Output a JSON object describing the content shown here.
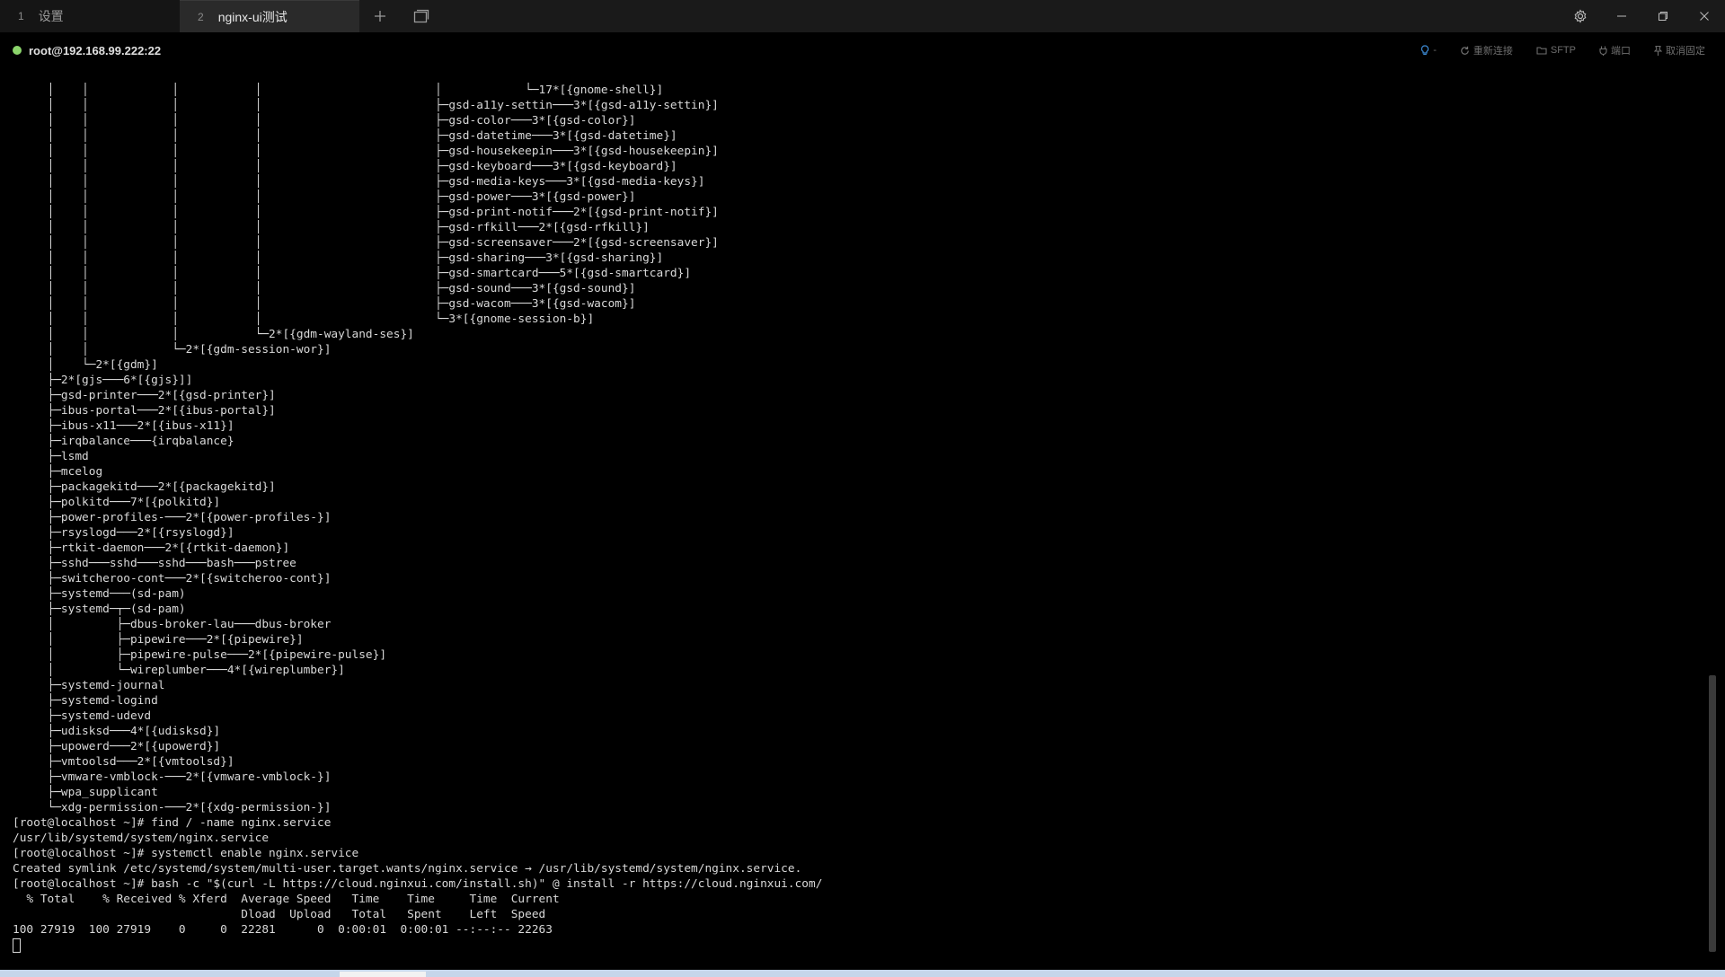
{
  "tabs": [
    {
      "num": "1",
      "label": "设置"
    },
    {
      "num": "2",
      "label": "nginx-ui测试"
    }
  ],
  "icons": {
    "new_tab": "plus-icon",
    "tab_overview": "tabs-icon",
    "settings": "gear-icon",
    "minimize": "minimize-icon",
    "restore": "restore-icon",
    "close": "close-icon"
  },
  "session": {
    "host": "root@192.168.99.222:22",
    "status_color": "#8bd46b",
    "bulb_label": "-",
    "reconnect": "重新连接",
    "sftp": "SFTP",
    "port": "端口",
    "unpin": "取消固定"
  },
  "terminal": {
    "lines": [
      "     │    │            │           │                         │            └─17*[{gnome-shell}]",
      "     │    │            │           │                         ├─gsd-a11y-settin───3*[{gsd-a11y-settin}]",
      "     │    │            │           │                         ├─gsd-color───3*[{gsd-color}]",
      "     │    │            │           │                         ├─gsd-datetime───3*[{gsd-datetime}]",
      "     │    │            │           │                         ├─gsd-housekeepin───3*[{gsd-housekeepin}]",
      "     │    │            │           │                         ├─gsd-keyboard───3*[{gsd-keyboard}]",
      "     │    │            │           │                         ├─gsd-media-keys───3*[{gsd-media-keys}]",
      "     │    │            │           │                         ├─gsd-power───3*[{gsd-power}]",
      "     │    │            │           │                         ├─gsd-print-notif───2*[{gsd-print-notif}]",
      "     │    │            │           │                         ├─gsd-rfkill───2*[{gsd-rfkill}]",
      "     │    │            │           │                         ├─gsd-screensaver───2*[{gsd-screensaver}]",
      "     │    │            │           │                         ├─gsd-sharing───3*[{gsd-sharing}]",
      "     │    │            │           │                         ├─gsd-smartcard───5*[{gsd-smartcard}]",
      "     │    │            │           │                         ├─gsd-sound───3*[{gsd-sound}]",
      "     │    │            │           │                         ├─gsd-wacom───3*[{gsd-wacom}]",
      "     │    │            │           │                         └─3*[{gnome-session-b}]",
      "     │    │            │           └─2*[{gdm-wayland-ses}]",
      "     │    │            └─2*[{gdm-session-wor}]",
      "     │    └─2*[{gdm}]",
      "     ├─2*[gjs───6*[{gjs}]]",
      "     ├─gsd-printer───2*[{gsd-printer}]",
      "     ├─ibus-portal───2*[{ibus-portal}]",
      "     ├─ibus-x11───2*[{ibus-x11}]",
      "     ├─irqbalance───{irqbalance}",
      "     ├─lsmd",
      "     ├─mcelog",
      "     ├─packagekitd───2*[{packagekitd}]",
      "     ├─polkitd───7*[{polkitd}]",
      "     ├─power-profiles-───2*[{power-profiles-}]",
      "     ├─rsyslogd───2*[{rsyslogd}]",
      "     ├─rtkit-daemon───2*[{rtkit-daemon}]",
      "     ├─sshd───sshd───sshd───bash───pstree",
      "     ├─switcheroo-cont───2*[{switcheroo-cont}]",
      "     ├─systemd───(sd-pam)",
      "     ├─systemd─┬─(sd-pam)",
      "     │         ├─dbus-broker-lau───dbus-broker",
      "     │         ├─pipewire───2*[{pipewire}]",
      "     │         ├─pipewire-pulse───2*[{pipewire-pulse}]",
      "     │         └─wireplumber───4*[{wireplumber}]",
      "     ├─systemd-journal",
      "     ├─systemd-logind",
      "     ├─systemd-udevd",
      "     ├─udisksd───4*[{udisksd}]",
      "     ├─upowerd───2*[{upowerd}]",
      "     ├─vmtoolsd───2*[{vmtoolsd}]",
      "     ├─vmware-vmblock-───2*[{vmware-vmblock-}]",
      "     ├─wpa_supplicant",
      "     └─xdg-permission-───2*[{xdg-permission-}]",
      "[root@localhost ~]# find / -name nginx.service",
      "/usr/lib/systemd/system/nginx.service",
      "[root@localhost ~]# systemctl enable nginx.service",
      "Created symlink /etc/systemd/system/multi-user.target.wants/nginx.service → /usr/lib/systemd/system/nginx.service.",
      "[root@localhost ~]# bash -c \"$(curl -L https://cloud.nginxui.com/install.sh)\" @ install -r https://cloud.nginxui.com/",
      "  % Total    % Received % Xferd  Average Speed   Time    Time     Time  Current",
      "                                 Dload  Upload   Total   Spent    Left  Speed",
      "100 27919  100 27919    0     0  22281      0  0:00:01  0:00:01 --:--:-- 22263"
    ]
  }
}
